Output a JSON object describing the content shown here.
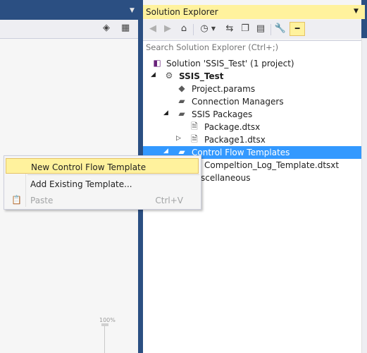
{
  "designer": {
    "toolbar_icons": [
      "cube-icon",
      "variables-grid-icon"
    ],
    "zoom_label": "100%"
  },
  "solution_explorer": {
    "title": "Solution Explorer",
    "search_placeholder": "Search Solution Explorer (Ctrl+;)",
    "toolbar_icons": [
      "back-icon",
      "forward-icon",
      "home-icon",
      "history-icon",
      "dropdown-arrow-icon",
      "sync-icon",
      "collapse-all-icon",
      "show-all-files-icon",
      "properties-wrench-icon",
      "pin-icon"
    ],
    "tree": {
      "solution": "Solution 'SSIS_Test' (1 project)",
      "project": "SSIS_Test",
      "project_params": "Project.params",
      "connection_managers": "Connection Managers",
      "ssis_packages": "SSIS Packages",
      "package": "Package.dtsx",
      "package1": "Package1.dtsx",
      "control_flow_templates": "Control Flow Templates",
      "template_file": "Compeltion_Log_Template.dtsxt",
      "miscellaneous": "scellaneous"
    }
  },
  "context_menu": {
    "items": [
      {
        "label": "New Control Flow Template",
        "shortcut": "",
        "state": "highlighted"
      },
      {
        "label": "Add Existing Template...",
        "shortcut": "",
        "state": "normal"
      },
      {
        "label": "Paste",
        "shortcut": "Ctrl+V",
        "state": "disabled"
      }
    ]
  },
  "colors": {
    "chrome_blue": "#2b4f82",
    "highlight_yellow": "#fff29d",
    "selection_blue": "#3399ff"
  }
}
